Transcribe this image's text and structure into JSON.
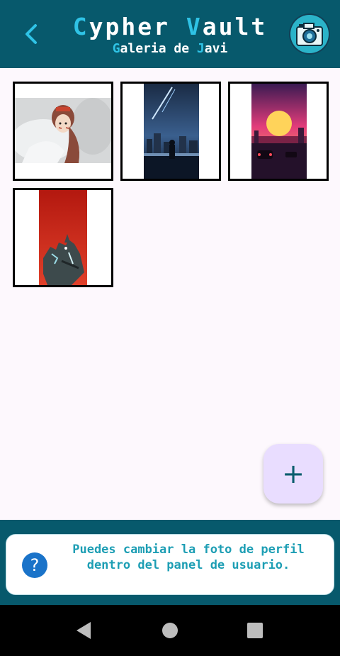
{
  "header": {
    "title": {
      "first_initial": "C",
      "first_rest": "ypher ",
      "second_initial": "V",
      "second_rest": "ault"
    },
    "subtitle": {
      "first_initial": "G",
      "first_rest": "aleria de ",
      "second_initial": "J",
      "second_rest": "avi"
    },
    "back_icon": "chevron-left-icon",
    "logo_icon": "camera-icon"
  },
  "gallery": {
    "items": [
      {
        "name": "anime-warrior-wolf"
      },
      {
        "name": "night-city-comet"
      },
      {
        "name": "synthwave-sunset"
      },
      {
        "name": "monster-red-background"
      }
    ]
  },
  "fab": {
    "label": "+"
  },
  "tip": {
    "icon_label": "?",
    "text": "Puedes cambiar la foto de perfil dentro del panel de usuario."
  },
  "navbar": {
    "back": "back-icon",
    "home": "home-icon",
    "recents": "recents-icon"
  },
  "colors": {
    "header_bg": "#07596c",
    "accent": "#2fc3e6",
    "tip_text": "#1d9eb4",
    "fab_bg": "#e9ddff"
  }
}
